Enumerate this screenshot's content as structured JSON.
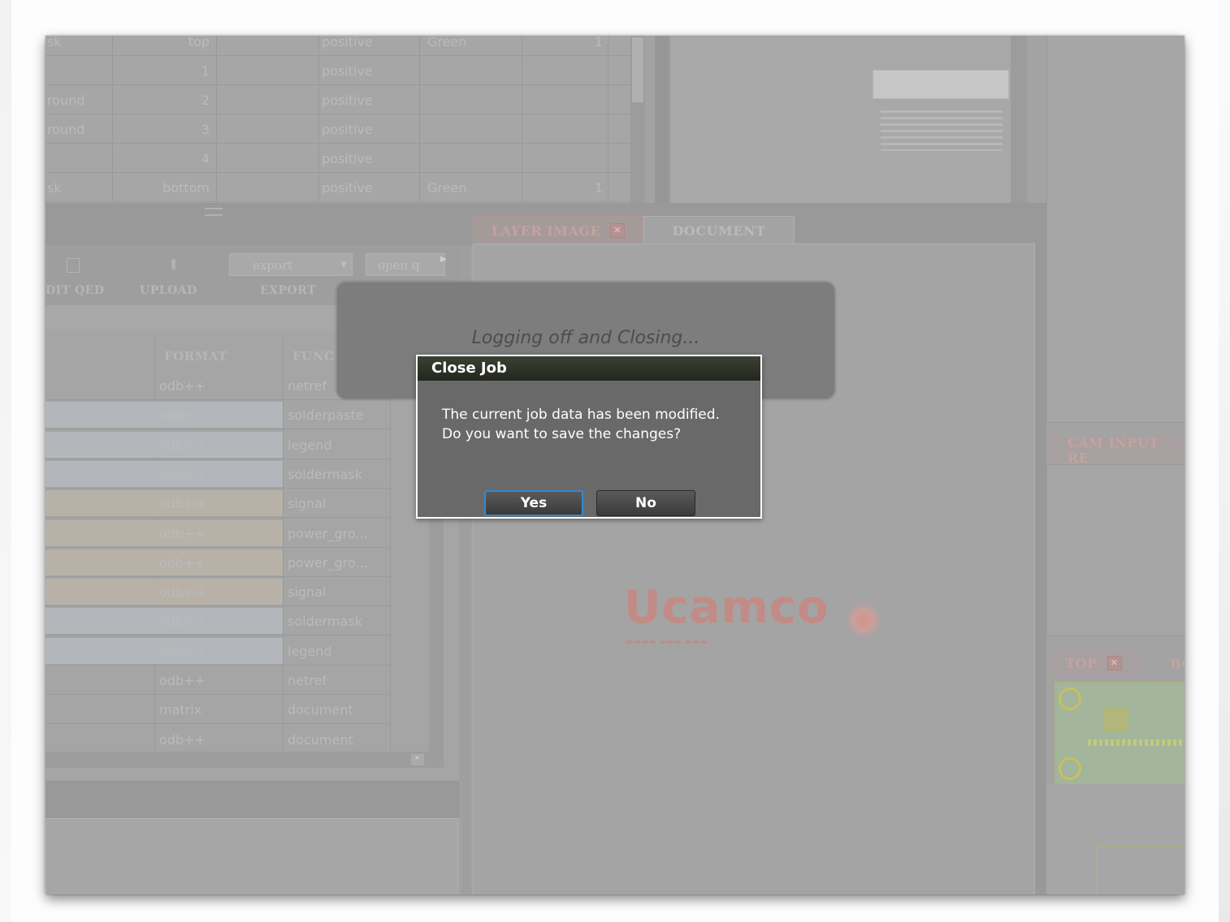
{
  "layers_top": {
    "rows": [
      {
        "name": "sk",
        "side": "top",
        "polarity": "positive",
        "color": "Green",
        "count": "1"
      },
      {
        "name": "",
        "side": "1",
        "polarity": "positive",
        "color": "",
        "count": ""
      },
      {
        "name": "round",
        "side": "2",
        "polarity": "positive",
        "color": "",
        "count": ""
      },
      {
        "name": "round",
        "side": "3",
        "polarity": "positive",
        "color": "",
        "count": ""
      },
      {
        "name": "",
        "side": "4",
        "polarity": "positive",
        "color": "",
        "count": ""
      },
      {
        "name": "sk",
        "side": "bottom",
        "polarity": "positive",
        "color": "Green",
        "count": "1"
      }
    ]
  },
  "toolbar": {
    "export_dropdown": "export",
    "open_button": "open q",
    "labels": [
      "DIT QED",
      "UPLOAD",
      "EXPORT"
    ]
  },
  "file_table": {
    "headers": [
      "FORMAT",
      "FUNC"
    ],
    "rows": [
      {
        "format": "odb++",
        "func": "netref",
        "tint": "none"
      },
      {
        "format": "odb++",
        "func": "solderpaste",
        "tint": "blue"
      },
      {
        "format": "odb++",
        "func": "legend",
        "tint": "blue"
      },
      {
        "format": "odb++",
        "func": "soldermask",
        "tint": "blue"
      },
      {
        "format": "odb++",
        "func": "signal",
        "tint": "tan"
      },
      {
        "format": "odb++",
        "func": "power_gro...",
        "tint": "tan"
      },
      {
        "format": "odb++",
        "func": "power_gro...",
        "tint": "tan"
      },
      {
        "format": "odb++",
        "func": "signal",
        "tint": "tan"
      },
      {
        "format": "odb++",
        "func": "soldermask",
        "tint": "blue"
      },
      {
        "format": "odb++",
        "func": "legend",
        "tint": "blue"
      },
      {
        "format": "odb++",
        "func": "netref",
        "tint": "none"
      },
      {
        "format": "matrix",
        "func": "document",
        "tint": "none"
      },
      {
        "format": "odb++",
        "func": "document",
        "tint": "none"
      }
    ]
  },
  "tabs": {
    "layer_image": "LAYER IMAGE",
    "document": "DOCUMENT",
    "cam_input": "CAM INPUT RE",
    "top": "TOP",
    "bottom": "BO"
  },
  "logo": {
    "text": "Ucamco"
  },
  "banner": {
    "text": "Logging off and Closing..."
  },
  "dialog": {
    "title": "Close Job",
    "message_line1": "The current job data has been modified.",
    "message_line2": "Do you want to save the changes?",
    "yes": "Yes",
    "no": "No"
  }
}
